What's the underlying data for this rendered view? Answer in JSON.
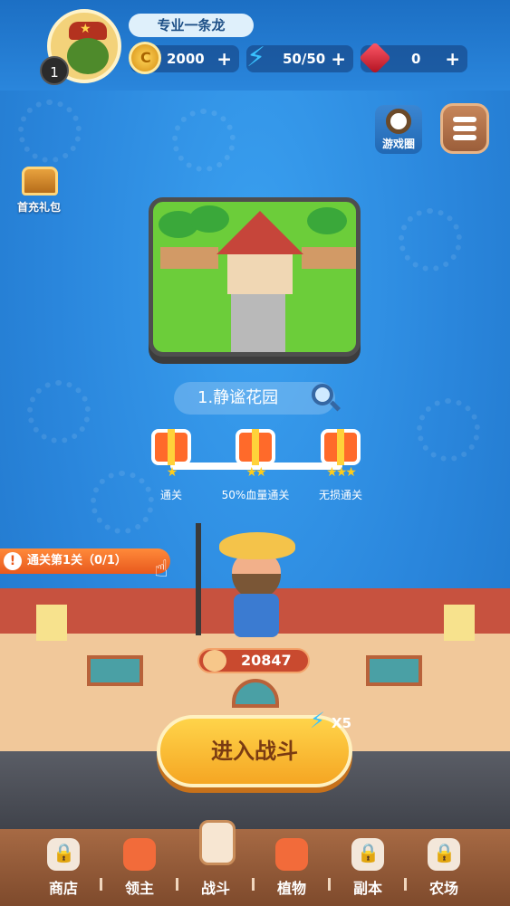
{
  "player": {
    "name": "专业一条龙",
    "level": "1"
  },
  "resources": {
    "coins": "2000",
    "energy": "50/50",
    "gems": "0",
    "plus": "+"
  },
  "buttons": {
    "game_circle": "游戏圈",
    "first_charge": "首充礼包",
    "battle": "进入战斗"
  },
  "level": {
    "name": "1.静谧花园"
  },
  "rewards": [
    {
      "stars": "★",
      "label": "通关"
    },
    {
      "stars": "★★",
      "label": "50%血量通关"
    },
    {
      "stars": "★★★",
      "label": "无损通关"
    }
  ],
  "task": {
    "text": "通关第1关（0/1）",
    "alert": "!"
  },
  "power": "20847",
  "energy_cost": "X5",
  "nav": {
    "items": [
      {
        "label": "商店"
      },
      {
        "label": "领主"
      },
      {
        "label": "战斗"
      },
      {
        "label": "植物"
      },
      {
        "label": "副本"
      },
      {
        "label": "农场"
      }
    ]
  },
  "colors": {
    "sky": "#2a86dc",
    "battle_button": "#f5a623",
    "nav_bar": "#8a5434",
    "task_bar": "#e8591e"
  },
  "icons": [
    "avatar",
    "coin-icon",
    "lightning-icon",
    "gem-icon",
    "plus-icon",
    "game-circle-icon",
    "menu-icon",
    "chest-icon",
    "search-icon",
    "gift-icon",
    "alert-icon",
    "hand-pointer-icon",
    "power-icon",
    "lock-icon"
  ]
}
